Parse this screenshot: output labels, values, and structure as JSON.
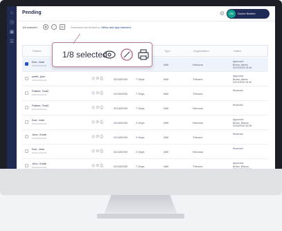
{
  "header": {
    "title": "Pending",
    "user_initials": "DB",
    "user_name": "Doctor Barbier"
  },
  "toolbar": {
    "selected_label": "1/8 selected",
    "notice": "Selections are limited to 50",
    "view_sign_label": "View and sign selected"
  },
  "callout": {
    "selected_label": "1/8 selected"
  },
  "table": {
    "columns": [
      "Patient",
      "",
      "",
      "ing",
      "Type",
      "Organization",
      "Status"
    ],
    "rows": [
      {
        "name": "Doe, Jane",
        "id": "DAR201901234",
        "date": "02/18/2000",
        "duration": "7 Days",
        "type": "AMI",
        "org": "Honrzon",
        "status": "Approved:\nBrown, Atermi\n02/13/2020 15:40",
        "selected": true
      },
      {
        "name": "smith, john",
        "id": "DAR201901234",
        "date": "02/18/2000",
        "duration": "7 Days",
        "type": "AMI",
        "org": "Thimurs",
        "status": "Approved:\nBrown, Atermi\n02/13/2020 15:40",
        "selected": false
      },
      {
        "name": "Patient, Test2",
        "id": "DAR201901234",
        "date": "02/18/2000",
        "duration": "7 Days",
        "type": "AMI",
        "org": "Thimurs",
        "status": "Received",
        "selected": false
      },
      {
        "name": "Patient, Test2",
        "id": "DAR201901234",
        "date": "02/18/2000",
        "duration": "7 Days",
        "type": "AMI",
        "org": "Hercean",
        "status": "Received",
        "selected": false
      },
      {
        "name": "Doe, Jane",
        "id": "DAR201901234",
        "date": "02/18/2000",
        "duration": "2 Days",
        "type": "AMI",
        "org": "Hercean",
        "status": "Approved:\nBrown, Blanca\n02/18/2020 20:28",
        "selected": false
      },
      {
        "name": "John, Smith",
        "id": "DAR201901234",
        "date": "02/18/2000",
        "duration": "2 Days",
        "type": "AMI",
        "org": "Thimurs",
        "status": "Received",
        "selected": false
      },
      {
        "name": "Doe, Jane",
        "id": "DAR201901234",
        "date": "02/18/2000",
        "duration": "2 Days",
        "type": "AMI",
        "org": "Hercean",
        "status": "Received",
        "selected": false
      },
      {
        "name": "John, Smith",
        "id": "DAR201901234",
        "date": "02/18/2000",
        "duration": "7 Days",
        "type": "AMI",
        "org": "Thimurs",
        "status": "Approved:\nBrown, Blanca\n02/18/2020 20:30",
        "selected": false
      }
    ]
  },
  "colors": {
    "nav_bg": "#202b52",
    "accent": "#2451c7",
    "avatar": "#11a38b",
    "callout_border": "#b77c98"
  }
}
